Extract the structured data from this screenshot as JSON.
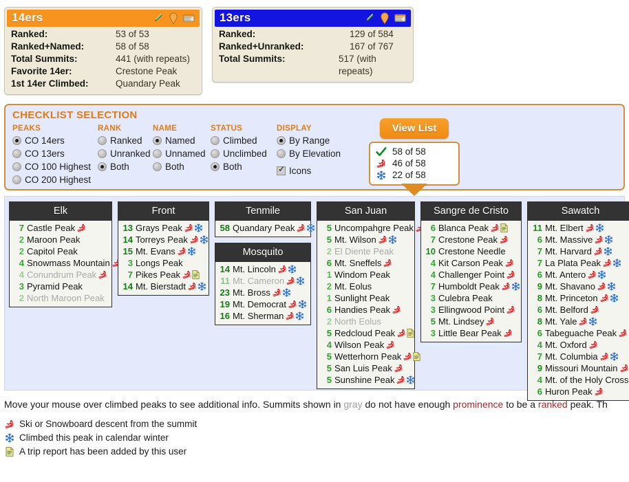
{
  "cards": [
    {
      "title": "14ers",
      "accent": "#f79420",
      "icons": [
        "pencil-icon",
        "map-pin-icon",
        "card-icon"
      ],
      "rows": [
        {
          "label": "Ranked:",
          "value": "53 of 53"
        },
        {
          "label": "Ranked+Named:",
          "value": "58 of 58"
        },
        {
          "label": "Total Summits:",
          "value": "441 (with repeats)"
        },
        {
          "label": "Favorite 14er:",
          "value": "Crestone Peak"
        },
        {
          "label": "1st 14er Climbed:",
          "value": "Quandary Peak"
        }
      ]
    },
    {
      "title": "13ers",
      "accent": "#1414e0",
      "icons": [
        "pencil-icon",
        "map-pin-icon",
        "card-icon"
      ],
      "rows": [
        {
          "label": "Ranked:",
          "value": "129 of 584"
        },
        {
          "label": "Ranked+Unranked:",
          "value": "167 of 767"
        },
        {
          "label": "Total Summits:",
          "value": "517 (with repeats)"
        }
      ]
    }
  ],
  "checklist": {
    "title": "CHECKLIST SELECTION",
    "groups": [
      {
        "label": "PEAKS",
        "type": "radio",
        "options": [
          {
            "label": "CO 14ers",
            "selected": true
          },
          {
            "label": "CO 13ers",
            "selected": false
          },
          {
            "label": "CO 100 Highest",
            "selected": false
          },
          {
            "label": "CO 200 Highest",
            "selected": false
          }
        ]
      },
      {
        "label": "RANK",
        "type": "radio",
        "options": [
          {
            "label": "Ranked",
            "selected": false
          },
          {
            "label": "Unranked",
            "selected": false
          },
          {
            "label": "Both",
            "selected": true
          }
        ]
      },
      {
        "label": "NAME",
        "type": "radio",
        "options": [
          {
            "label": "Named",
            "selected": true
          },
          {
            "label": "Unnamed",
            "selected": false
          },
          {
            "label": "Both",
            "selected": false
          }
        ]
      },
      {
        "label": "STATUS",
        "type": "radio",
        "options": [
          {
            "label": "Climbed",
            "selected": false
          },
          {
            "label": "Unclimbed",
            "selected": false
          },
          {
            "label": "Both",
            "selected": true
          }
        ]
      },
      {
        "label": "DISPLAY",
        "type": "mixed",
        "options": [
          {
            "label": "By Range",
            "selected": true,
            "control": "radio"
          },
          {
            "label": "By Elevation",
            "selected": false,
            "control": "radio"
          },
          {
            "label": "Icons",
            "selected": true,
            "control": "checkbox",
            "spaced": true
          }
        ]
      }
    ],
    "view_list_label": "View List",
    "counts": [
      {
        "icon": "check-icon",
        "value": "58 of 58"
      },
      {
        "icon": "skier-icon",
        "value": "46 of 58"
      },
      {
        "icon": "snowflake-icon",
        "value": "22 of 58"
      }
    ]
  },
  "columns": [
    {
      "key": "elk",
      "boxes": [
        {
          "header": "Elk",
          "peaks": [
            {
              "num": "7",
              "name": "Castle Peak",
              "unranked": false,
              "icons": [
                "skier-icon"
              ]
            },
            {
              "num": "2",
              "name": "Maroon Peak",
              "unranked": false,
              "icons": []
            },
            {
              "num": "2",
              "name": "Capitol Peak",
              "unranked": false,
              "icons": []
            },
            {
              "num": "4",
              "name": "Snowmass Mountain",
              "unranked": false,
              "icons": [
                "skier-icon"
              ]
            },
            {
              "num": "4",
              "name": "Conundrum Peak",
              "unranked": true,
              "icons": [
                "skier-icon"
              ]
            },
            {
              "num": "3",
              "name": "Pyramid Peak",
              "unranked": false,
              "icons": []
            },
            {
              "num": "2",
              "name": "North Maroon Peak",
              "unranked": true,
              "icons": []
            }
          ]
        }
      ]
    },
    {
      "key": "front",
      "boxes": [
        {
          "header": "Front",
          "peaks": [
            {
              "num": "13",
              "name": "Grays Peak",
              "unranked": false,
              "icons": [
                "skier-icon",
                "snowflake-icon"
              ]
            },
            {
              "num": "14",
              "name": "Torreys Peak",
              "unranked": false,
              "icons": [
                "skier-icon",
                "snowflake-icon"
              ]
            },
            {
              "num": "15",
              "name": "Mt. Evans",
              "unranked": false,
              "icons": [
                "skier-icon",
                "snowflake-icon"
              ]
            },
            {
              "num": "3",
              "name": "Longs Peak",
              "unranked": false,
              "icons": []
            },
            {
              "num": "7",
              "name": "Pikes Peak",
              "unranked": false,
              "icons": [
                "skier-icon",
                "report-icon"
              ]
            },
            {
              "num": "14",
              "name": "Mt. Bierstadt",
              "unranked": false,
              "icons": [
                "skier-icon",
                "snowflake-icon"
              ]
            }
          ]
        }
      ]
    },
    {
      "key": "tenmile",
      "boxes": [
        {
          "header": "Tenmile",
          "peaks": [
            {
              "num": "58",
              "name": "Quandary Peak",
              "unranked": false,
              "icons": [
                "skier-icon",
                "snowflake-icon"
              ]
            }
          ]
        },
        {
          "header": "Mosquito",
          "peaks": [
            {
              "num": "14",
              "name": "Mt. Lincoln",
              "unranked": false,
              "icons": [
                "skier-icon",
                "snowflake-icon"
              ]
            },
            {
              "num": "11",
              "name": "Mt. Cameron",
              "unranked": true,
              "icons": [
                "skier-icon",
                "snowflake-icon"
              ]
            },
            {
              "num": "23",
              "name": "Mt. Bross",
              "unranked": false,
              "icons": [
                "skier-icon",
                "snowflake-icon"
              ]
            },
            {
              "num": "19",
              "name": "Mt. Democrat",
              "unranked": false,
              "icons": [
                "skier-icon",
                "snowflake-icon"
              ]
            },
            {
              "num": "16",
              "name": "Mt. Sherman",
              "unranked": false,
              "icons": [
                "skier-icon",
                "snowflake-icon"
              ]
            }
          ]
        }
      ]
    },
    {
      "key": "sanjuan",
      "boxes": [
        {
          "header": "San Juan",
          "peaks": [
            {
              "num": "5",
              "name": "Uncompahgre Peak",
              "unranked": false,
              "icons": [
                "skier-icon"
              ]
            },
            {
              "num": "5",
              "name": "Mt. Wilson",
              "unranked": false,
              "icons": [
                "skier-icon",
                "snowflake-icon"
              ]
            },
            {
              "num": "2",
              "name": "El Diente Peak",
              "unranked": true,
              "icons": []
            },
            {
              "num": "6",
              "name": "Mt. Sneffels",
              "unranked": false,
              "icons": [
                "skier-icon"
              ]
            },
            {
              "num": "1",
              "name": "Windom Peak",
              "unranked": false,
              "icons": []
            },
            {
              "num": "2",
              "name": "Mt. Eolus",
              "unranked": false,
              "icons": []
            },
            {
              "num": "1",
              "name": "Sunlight Peak",
              "unranked": false,
              "icons": []
            },
            {
              "num": "6",
              "name": "Handies Peak",
              "unranked": false,
              "icons": [
                "skier-icon"
              ]
            },
            {
              "num": "2",
              "name": "North Eolus",
              "unranked": true,
              "icons": []
            },
            {
              "num": "5",
              "name": "Redcloud Peak",
              "unranked": false,
              "icons": [
                "skier-icon",
                "report-icon"
              ]
            },
            {
              "num": "4",
              "name": "Wilson Peak",
              "unranked": false,
              "icons": [
                "skier-icon"
              ]
            },
            {
              "num": "5",
              "name": "Wetterhorn Peak",
              "unranked": false,
              "icons": [
                "skier-icon",
                "report-icon"
              ]
            },
            {
              "num": "5",
              "name": "San Luis Peak",
              "unranked": false,
              "icons": [
                "skier-icon"
              ]
            },
            {
              "num": "5",
              "name": "Sunshine Peak",
              "unranked": false,
              "icons": [
                "skier-icon",
                "snowflake-icon"
              ]
            }
          ]
        }
      ]
    },
    {
      "key": "sangre",
      "boxes": [
        {
          "header": "Sangre de Cristo",
          "peaks": [
            {
              "num": "6",
              "name": "Blanca Peak",
              "unranked": false,
              "icons": [
                "skier-icon",
                "report-icon"
              ]
            },
            {
              "num": "7",
              "name": "Crestone Peak",
              "unranked": false,
              "icons": [
                "skier-icon"
              ]
            },
            {
              "num": "10",
              "name": "Crestone Needle",
              "unranked": false,
              "icons": []
            },
            {
              "num": "4",
              "name": "Kit Carson Peak",
              "unranked": false,
              "icons": [
                "skier-icon"
              ]
            },
            {
              "num": "4",
              "name": "Challenger Point",
              "unranked": false,
              "icons": [
                "skier-icon"
              ]
            },
            {
              "num": "7",
              "name": "Humboldt Peak",
              "unranked": false,
              "icons": [
                "skier-icon",
                "snowflake-icon"
              ]
            },
            {
              "num": "3",
              "name": "Culebra Peak",
              "unranked": false,
              "icons": []
            },
            {
              "num": "3",
              "name": "Ellingwood Point",
              "unranked": false,
              "icons": [
                "skier-icon"
              ]
            },
            {
              "num": "5",
              "name": "Mt. Lindsey",
              "unranked": false,
              "icons": [
                "skier-icon"
              ]
            },
            {
              "num": "3",
              "name": "Little Bear Peak",
              "unranked": false,
              "icons": [
                "skier-icon"
              ]
            }
          ]
        }
      ]
    },
    {
      "key": "sawatch",
      "boxes": [
        {
          "header": "Sawatch",
          "peaks": [
            {
              "num": "11",
              "name": "Mt. Elbert",
              "unranked": false,
              "icons": [
                "skier-icon",
                "snowflake-icon"
              ]
            },
            {
              "num": "6",
              "name": "Mt. Massive",
              "unranked": false,
              "icons": [
                "skier-icon",
                "snowflake-icon"
              ]
            },
            {
              "num": "7",
              "name": "Mt. Harvard",
              "unranked": false,
              "icons": [
                "skier-icon",
                "snowflake-icon"
              ]
            },
            {
              "num": "7",
              "name": "La Plata Peak",
              "unranked": false,
              "icons": [
                "skier-icon",
                "snowflake-icon"
              ]
            },
            {
              "num": "6",
              "name": "Mt. Antero",
              "unranked": false,
              "icons": [
                "skier-icon",
                "snowflake-icon"
              ]
            },
            {
              "num": "9",
              "name": "Mt. Shavano",
              "unranked": false,
              "icons": [
                "skier-icon",
                "snowflake-icon"
              ]
            },
            {
              "num": "8",
              "name": "Mt. Princeton",
              "unranked": false,
              "icons": [
                "skier-icon",
                "snowflake-icon"
              ]
            },
            {
              "num": "6",
              "name": "Mt. Belford",
              "unranked": false,
              "icons": [
                "skier-icon"
              ]
            },
            {
              "num": "8",
              "name": "Mt. Yale",
              "unranked": false,
              "icons": [
                "skier-icon",
                "snowflake-icon"
              ]
            },
            {
              "num": "6",
              "name": "Tabeguache Peak",
              "unranked": false,
              "icons": [
                "skier-icon"
              ]
            },
            {
              "num": "4",
              "name": "Mt. Oxford",
              "unranked": false,
              "icons": [
                "skier-icon"
              ]
            },
            {
              "num": "7",
              "name": "Mt. Columbia",
              "unranked": false,
              "icons": [
                "skier-icon",
                "snowflake-icon"
              ]
            },
            {
              "num": "9",
              "name": "Missouri Mountain",
              "unranked": false,
              "icons": [
                "skier-icon"
              ]
            },
            {
              "num": "4",
              "name": "Mt. of the Holy Cross",
              "unranked": false,
              "icons": [
                "skier-icon"
              ]
            },
            {
              "num": "6",
              "name": "Huron Peak",
              "unranked": false,
              "icons": [
                "skier-icon"
              ]
            }
          ]
        }
      ]
    }
  ],
  "footer": {
    "note_parts": [
      {
        "text": "Move your mouse over climbed peaks to see additional info. Summits shown in ",
        "style": "plain"
      },
      {
        "text": "gray",
        "style": "gray"
      },
      {
        "text": " do not have enough ",
        "style": "plain"
      },
      {
        "text": "prominence",
        "style": "red"
      },
      {
        "text": " to be a ",
        "style": "plain"
      },
      {
        "text": "ranked",
        "style": "red"
      },
      {
        "text": " peak. Th",
        "style": "plain"
      }
    ],
    "legend": [
      {
        "icon": "skier-icon",
        "text": "Ski or Snowboard descent from the summit"
      },
      {
        "icon": "snowflake-icon",
        "text": "Climbed this peak in calendar winter"
      },
      {
        "icon": "report-icon",
        "text": "A trip report has been added by this user"
      }
    ]
  }
}
